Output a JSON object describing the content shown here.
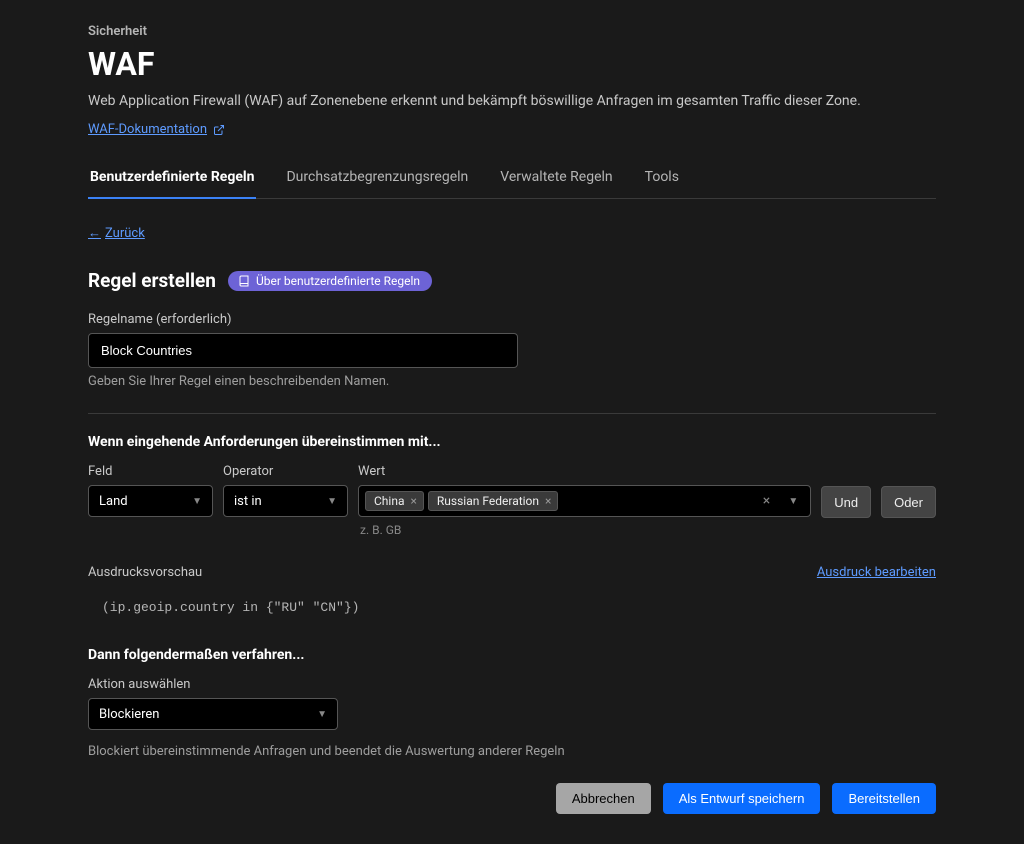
{
  "breadcrumb": "Sicherheit",
  "page_title": "WAF",
  "page_desc": "Web Application Firewall (WAF) auf Zonenebene erkennt und bekämpft böswillige Anfragen im gesamten Traffic dieser Zone.",
  "doc_link": "WAF-Dokumentation",
  "tabs": {
    "custom": "Benutzerdefinierte Regeln",
    "rate": "Durchsatzbegrenzungsregeln",
    "managed": "Verwaltete Regeln",
    "tools": "Tools"
  },
  "back": "Zurück",
  "create_rule_title": "Regel erstellen",
  "about_pill": "Über benutzerdefinierte Regeln",
  "rule_name_label": "Regelname (erforderlich)",
  "rule_name_value": "Block Countries",
  "rule_name_helper": "Geben Sie Ihrer Regel einen beschreibenden Namen.",
  "match_heading": "Wenn eingehende Anforderungen übereinstimmen mit...",
  "labels": {
    "field": "Feld",
    "operator": "Operator",
    "value": "Wert"
  },
  "field_value": "Land",
  "operator_value": "ist in",
  "value_tags": [
    "China",
    "Russian Federation"
  ],
  "value_example": "z. B. GB",
  "and_label": "Und",
  "or_label": "Oder",
  "preview_label": "Ausdrucksvorschau",
  "edit_expr": "Ausdruck bearbeiten",
  "expression": "(ip.geoip.country in {\"RU\" \"CN\"})",
  "then_heading": "Dann folgendermaßen verfahren...",
  "action_label": "Aktion auswählen",
  "action_value": "Blockieren",
  "action_helper": "Blockiert übereinstimmende Anfragen und beendet die Auswertung anderer Regeln",
  "buttons": {
    "cancel": "Abbrechen",
    "draft": "Als Entwurf speichern",
    "deploy": "Bereitstellen"
  }
}
